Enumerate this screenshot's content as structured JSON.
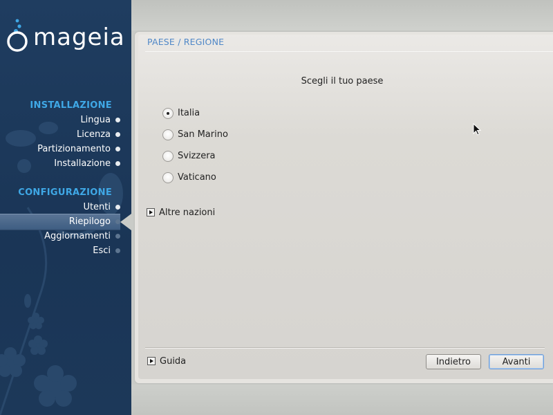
{
  "brand": {
    "name": "mageia"
  },
  "sidebar": {
    "sections": [
      {
        "title": "INSTALLAZIONE",
        "steps": [
          "Lingua",
          "Licenza",
          "Partizionamento",
          "Installazione"
        ]
      },
      {
        "title": "CONFIGURAZIONE",
        "steps": [
          "Utenti",
          "Riepilogo",
          "Aggiornamenti",
          "Esci"
        ]
      }
    ],
    "active_step": "Riepilogo"
  },
  "header": {
    "title": "PAESE / REGIONE"
  },
  "main": {
    "prompt": "Scegli il tuo paese",
    "options": [
      "Italia",
      "San Marino",
      "Svizzera",
      "Vaticano"
    ],
    "selected": "Italia",
    "more_expander": "Altre nazioni"
  },
  "footer": {
    "help_expander": "Guida",
    "back_label": "Indietro",
    "next_label": "Avanti"
  },
  "colors": {
    "sidebar_bg": "#1e3a5c",
    "section_title": "#3fa8e6",
    "header_title": "#4f87c7"
  }
}
